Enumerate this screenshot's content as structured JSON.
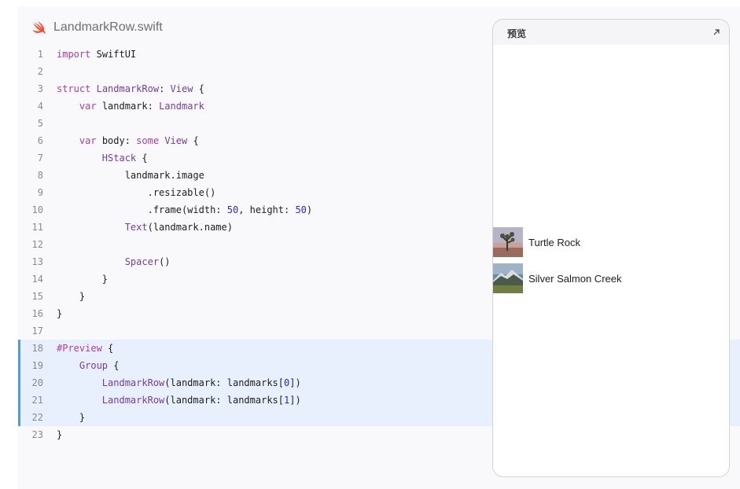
{
  "file": {
    "name": "LandmarkRow.swift",
    "icon": "swift-logo-icon"
  },
  "code_lines": [
    {
      "n": "1",
      "tokens": [
        {
          "t": "import",
          "c": "kw"
        },
        {
          "t": " SwiftUI",
          "c": ""
        }
      ]
    },
    {
      "n": "2",
      "tokens": []
    },
    {
      "n": "3",
      "tokens": [
        {
          "t": "struct",
          "c": "kw"
        },
        {
          "t": " ",
          "c": ""
        },
        {
          "t": "LandmarkRow",
          "c": "ty"
        },
        {
          "t": ": ",
          "c": ""
        },
        {
          "t": "View",
          "c": "ty"
        },
        {
          "t": " {",
          "c": ""
        }
      ]
    },
    {
      "n": "4",
      "tokens": [
        {
          "t": "    ",
          "c": ""
        },
        {
          "t": "var",
          "c": "kw"
        },
        {
          "t": " landmark: ",
          "c": ""
        },
        {
          "t": "Landmark",
          "c": "ty"
        }
      ]
    },
    {
      "n": "5",
      "tokens": []
    },
    {
      "n": "6",
      "tokens": [
        {
          "t": "    ",
          "c": ""
        },
        {
          "t": "var",
          "c": "kw"
        },
        {
          "t": " body: ",
          "c": ""
        },
        {
          "t": "some",
          "c": "kw"
        },
        {
          "t": " ",
          "c": ""
        },
        {
          "t": "View",
          "c": "ty"
        },
        {
          "t": " {",
          "c": ""
        }
      ]
    },
    {
      "n": "7",
      "tokens": [
        {
          "t": "        ",
          "c": ""
        },
        {
          "t": "HStack",
          "c": "ty"
        },
        {
          "t": " {",
          "c": ""
        }
      ]
    },
    {
      "n": "8",
      "tokens": [
        {
          "t": "            landmark.image",
          "c": ""
        }
      ]
    },
    {
      "n": "9",
      "tokens": [
        {
          "t": "                .resizable()",
          "c": ""
        }
      ]
    },
    {
      "n": "10",
      "tokens": [
        {
          "t": "                .frame(width: ",
          "c": ""
        },
        {
          "t": "50",
          "c": "num"
        },
        {
          "t": ", height: ",
          "c": ""
        },
        {
          "t": "50",
          "c": "num"
        },
        {
          "t": ")",
          "c": ""
        }
      ]
    },
    {
      "n": "11",
      "tokens": [
        {
          "t": "            ",
          "c": ""
        },
        {
          "t": "Text",
          "c": "ty"
        },
        {
          "t": "(landmark.name)",
          "c": ""
        }
      ]
    },
    {
      "n": "12",
      "tokens": []
    },
    {
      "n": "13",
      "tokens": [
        {
          "t": "            ",
          "c": ""
        },
        {
          "t": "Spacer",
          "c": "ty"
        },
        {
          "t": "()",
          "c": ""
        }
      ]
    },
    {
      "n": "14",
      "tokens": [
        {
          "t": "        }",
          "c": ""
        }
      ]
    },
    {
      "n": "15",
      "tokens": [
        {
          "t": "    }",
          "c": ""
        }
      ]
    },
    {
      "n": "16",
      "tokens": [
        {
          "t": "}",
          "c": ""
        }
      ]
    },
    {
      "n": "17",
      "tokens": []
    },
    {
      "n": "18",
      "hl": true,
      "tokens": [
        {
          "t": "#Preview",
          "c": "kw"
        },
        {
          "t": " {",
          "c": ""
        }
      ]
    },
    {
      "n": "19",
      "hl": true,
      "tokens": [
        {
          "t": "    ",
          "c": ""
        },
        {
          "t": "Group",
          "c": "ty"
        },
        {
          "t": " {",
          "c": ""
        }
      ]
    },
    {
      "n": "20",
      "hl": true,
      "tokens": [
        {
          "t": "        ",
          "c": ""
        },
        {
          "t": "LandmarkRow",
          "c": "ty"
        },
        {
          "t": "(landmark: landmarks[",
          "c": ""
        },
        {
          "t": "0",
          "c": "num"
        },
        {
          "t": "])",
          "c": ""
        }
      ]
    },
    {
      "n": "21",
      "hl": true,
      "tokens": [
        {
          "t": "        ",
          "c": ""
        },
        {
          "t": "LandmarkRow",
          "c": "ty"
        },
        {
          "t": "(landmark: landmarks[",
          "c": ""
        },
        {
          "t": "1",
          "c": "num"
        },
        {
          "t": "])",
          "c": ""
        }
      ]
    },
    {
      "n": "22",
      "hl": true,
      "tokens": [
        {
          "t": "    }",
          "c": ""
        }
      ]
    },
    {
      "n": "23",
      "tokens": [
        {
          "t": "}",
          "c": ""
        }
      ]
    }
  ],
  "preview": {
    "title": "预览",
    "expand_icon": "expand-arrow-icon",
    "rows": [
      {
        "label": "Turtle Rock"
      },
      {
        "label": "Silver Salmon Creek"
      }
    ]
  },
  "colors": {
    "keyword": "#ad3da4",
    "type": "#703daa",
    "number": "#272ad8",
    "highlight": "#e8f0fd",
    "highlight_bar": "#4b9be7"
  }
}
